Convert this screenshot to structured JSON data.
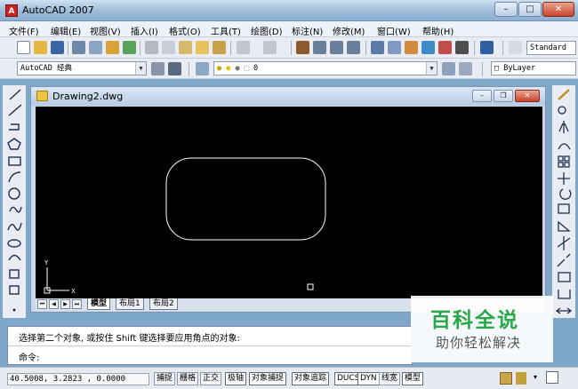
{
  "window": {
    "title": "AutoCAD 2007",
    "app_icon_glyph": "A",
    "minimize": "–",
    "maximize": "□",
    "close": "✕"
  },
  "menu": [
    "文件(F)",
    "编辑(E)",
    "视图(V)",
    "插入(I)",
    "格式(O)",
    "工具(T)",
    "绘图(D)",
    "标注(N)",
    "修改(M)",
    "窗口(W)",
    "帮助(H)"
  ],
  "toolbar": {
    "text_style_value": "Standard",
    "workspace_value": "AutoCAD 经典",
    "layer_value": "0",
    "color_value": "ByLayer"
  },
  "document": {
    "title": "Drawing2.dwg",
    "minimize": "–",
    "restore": "❐",
    "close": "✕"
  },
  "ucs": {
    "x_label": "X",
    "y_label": "Y"
  },
  "tabs": {
    "nav": [
      "⏮",
      "◀",
      "▶",
      "⏭"
    ],
    "items": [
      "模型",
      "布局1",
      "布局2"
    ]
  },
  "command": {
    "line1": "选择第二个对象, 或按住 Shift 键选择要应用角点的对象:",
    "line2": "命令:"
  },
  "status": {
    "coordinates": "40.5008, 3.2823 , 0.0000",
    "toggles": [
      {
        "label": "捕捉",
        "on": false
      },
      {
        "label": "栅格",
        "on": false
      },
      {
        "label": "正交",
        "on": false
      },
      {
        "label": "极轴",
        "on": true
      },
      {
        "label": "对象捕捉",
        "on": true
      },
      {
        "label": "对象追踪",
        "on": true
      },
      {
        "label": "DUCS",
        "on": true
      },
      {
        "label": "DYN",
        "on": true
      },
      {
        "label": "线宽",
        "on": false
      },
      {
        "label": "模型",
        "on": true
      }
    ]
  },
  "watermark": {
    "brand": "百科全说",
    "subtitle": "助你轻松解决"
  },
  "colors": {
    "canvas": "#000000",
    "geometry": "#ffffff",
    "watermark_green": "#2aa84a"
  }
}
